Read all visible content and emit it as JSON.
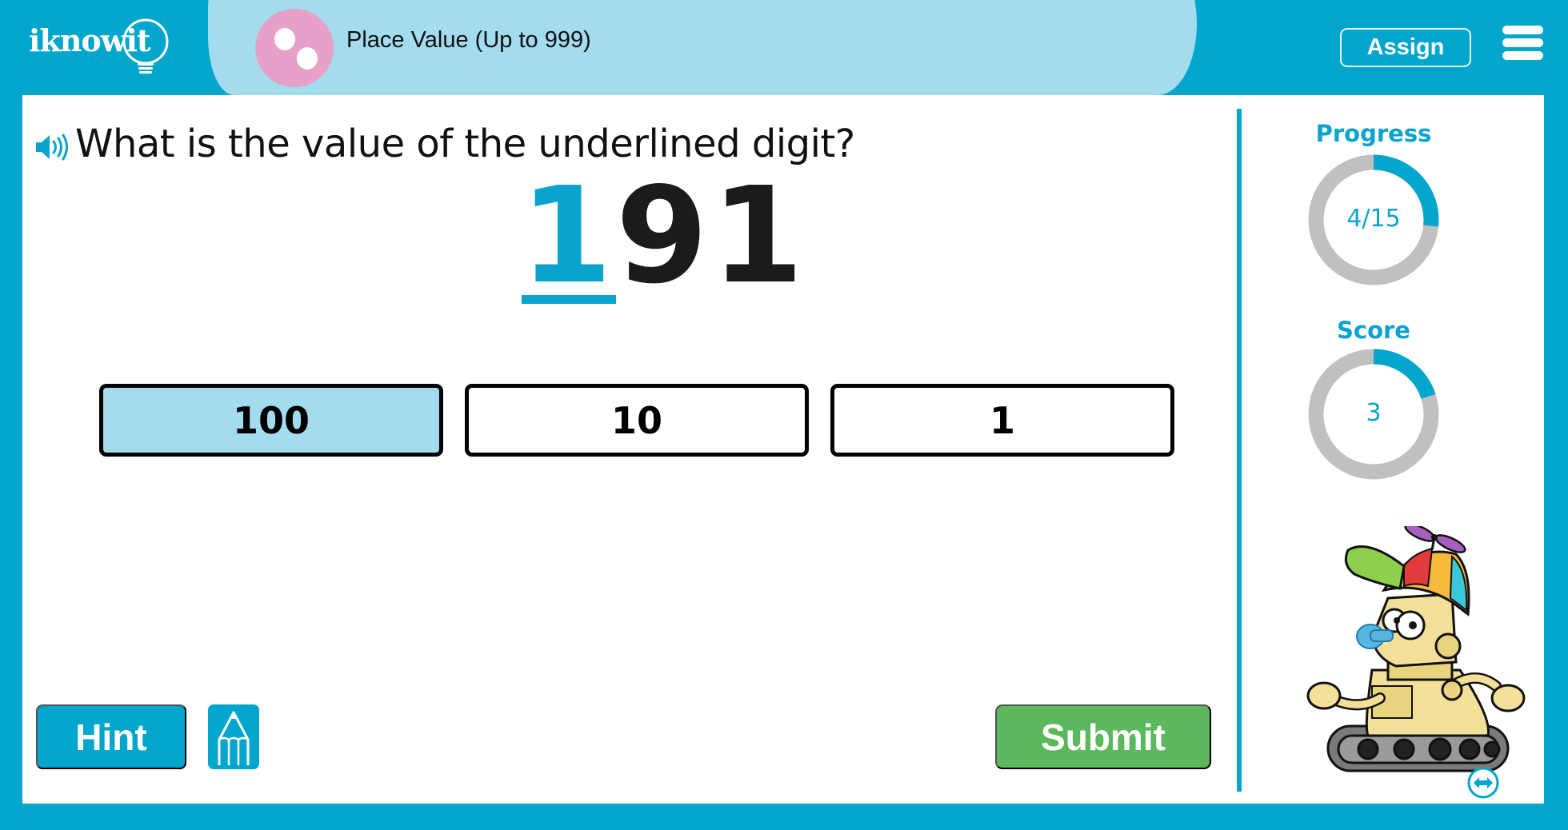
{
  "header": {
    "logo_text": "iknowit",
    "lesson_title": "Place Value (Up to 999)",
    "lesson_icon": "two-dots-icon",
    "assign_label": "Assign",
    "menu_icon": "hamburger-menu-icon"
  },
  "question": {
    "speaker_icon": "speaker-icon",
    "text": "What is the value of the underlined digit?",
    "number": {
      "underlined_digit": "1",
      "rest": "91",
      "highlight_color": "#0aa3cf"
    }
  },
  "answers": [
    {
      "label": "100",
      "selected": true
    },
    {
      "label": "10",
      "selected": false
    },
    {
      "label": "1",
      "selected": false
    }
  ],
  "actions": {
    "hint_label": "Hint",
    "pencil_icon": "pencil-icon",
    "submit_label": "Submit"
  },
  "sidebar": {
    "progress": {
      "label": "Progress",
      "value_text": "4/15",
      "completed": 4,
      "total": 15
    },
    "score": {
      "label": "Score",
      "value_text": "3",
      "value": 3,
      "max": 15
    },
    "mascot": "robot-with-propeller-cap",
    "resize_icon": "resize-arrows-icon"
  },
  "colors": {
    "brand_blue": "#02a6cc",
    "pill_light_blue": "#a2dcee",
    "selected_answer": "#a3dcee",
    "submit_green": "#5cb85c",
    "ring_track": "#c0c0c0",
    "ring_fill": "#02a6cc",
    "lesson_icon_pink": "#e7a0c7"
  }
}
